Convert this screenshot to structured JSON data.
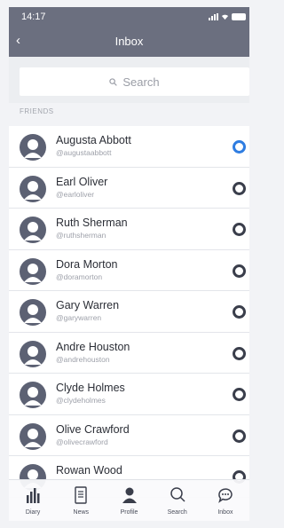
{
  "status_bar": {
    "time": "14:17"
  },
  "nav": {
    "back_glyph": "‹",
    "title": "Inbox"
  },
  "search": {
    "placeholder": "Search",
    "icon": "search-icon"
  },
  "section_header": "FRIENDS",
  "friends": [
    {
      "name": "Augusta Abbott",
      "handle": "@augustaabbott",
      "selected": true
    },
    {
      "name": "Earl Oliver",
      "handle": "@earloliver",
      "selected": false
    },
    {
      "name": "Ruth Sherman",
      "handle": "@ruthsherman",
      "selected": false
    },
    {
      "name": "Dora Morton",
      "handle": "@doramorton",
      "selected": false
    },
    {
      "name": "Gary Warren",
      "handle": "@garywarren",
      "selected": false
    },
    {
      "name": "Andre Houston",
      "handle": "@andrehouston",
      "selected": false
    },
    {
      "name": "Clyde Holmes",
      "handle": "@clydeholmes",
      "selected": false
    },
    {
      "name": "Olive Crawford",
      "handle": "@olivecrawford",
      "selected": false
    },
    {
      "name": "Rowan Wood",
      "handle": "",
      "selected": false
    }
  ],
  "tabs": [
    {
      "label": "Diary",
      "icon": "bar-chart-icon"
    },
    {
      "label": "News",
      "icon": "document-icon"
    },
    {
      "label": "Profile",
      "icon": "person-icon"
    },
    {
      "label": "Search",
      "icon": "search-icon"
    },
    {
      "label": "Inbox",
      "icon": "chat-bubble-icon"
    }
  ],
  "colors": {
    "header": "#6b6f7f",
    "accent": "#2f7de1",
    "avatar": "#5c6173"
  }
}
